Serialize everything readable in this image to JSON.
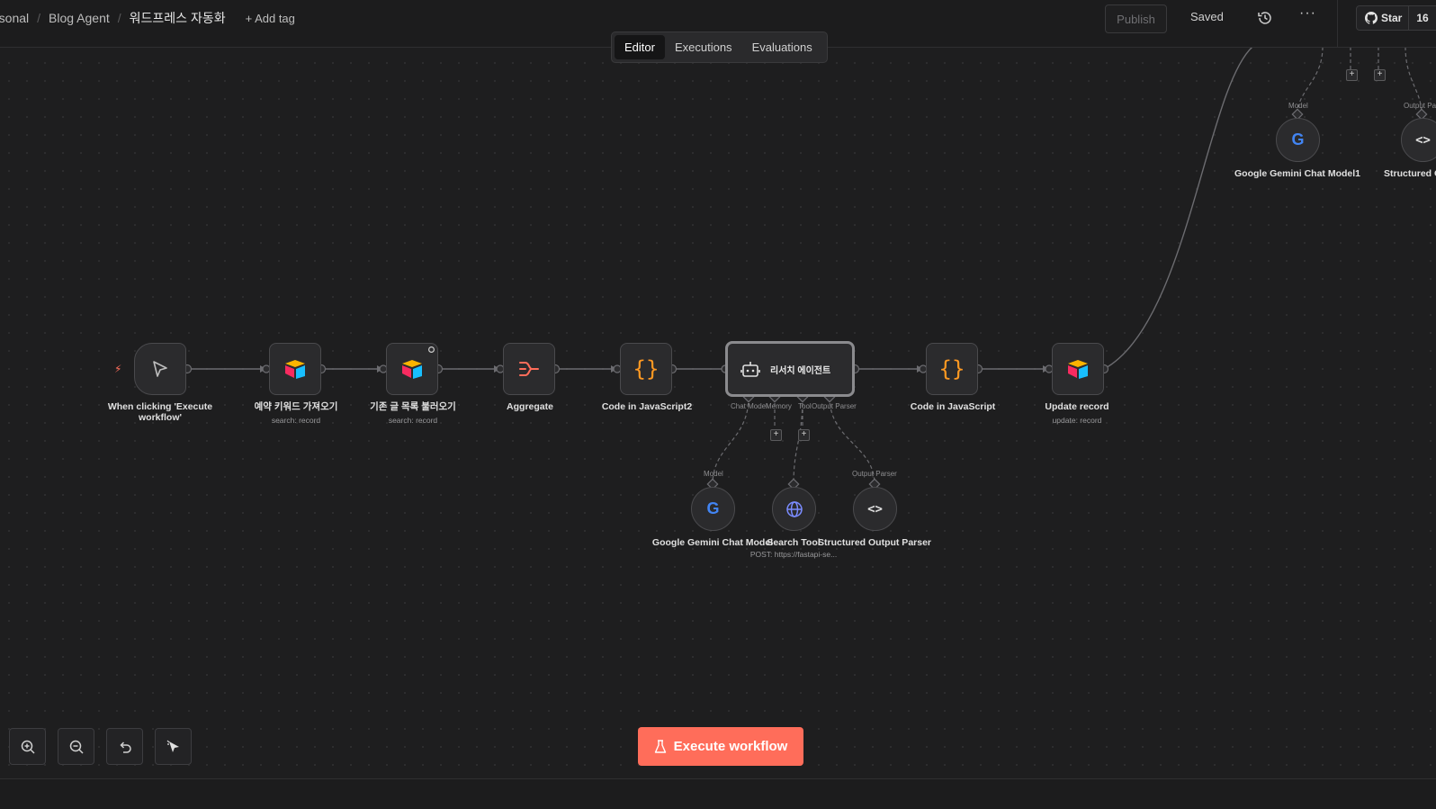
{
  "header": {
    "breadcrumb": [
      "rsonal",
      "Blog Agent",
      "워드프레스 자동화"
    ],
    "separator": "/",
    "add_tag": "+ Add tag",
    "publish": "Publish",
    "saved": "Saved",
    "more": "···",
    "github_star": "Star",
    "star_count": "16"
  },
  "tabs": [
    {
      "label": "Editor",
      "active": true
    },
    {
      "label": "Executions",
      "active": false
    },
    {
      "label": "Evaluations",
      "active": false
    }
  ],
  "nodes": {
    "trigger": {
      "title": "When clicking 'Execute workflow'",
      "icon": "cursor-icon"
    },
    "get_keywords": {
      "title": "예약 키워드 가져오기",
      "subtitle": "search: record",
      "icon": "airtable-icon"
    },
    "get_posts": {
      "title": "기존 글 목록 불러오기",
      "subtitle": "search: record",
      "icon": "airtable-icon"
    },
    "aggregate": {
      "title": "Aggregate",
      "icon": "aggregate-icon"
    },
    "code2": {
      "title": "Code in JavaScript2",
      "icon": "braces-icon"
    },
    "agent": {
      "title": "리서치 에이전트",
      "icon": "robot-icon"
    },
    "code": {
      "title": "Code in JavaScript",
      "icon": "braces-icon"
    },
    "update": {
      "title": "Update record",
      "subtitle": "update: record",
      "icon": "airtable-icon"
    }
  },
  "agent_ports": {
    "chat_model": "Chat Model",
    "memory": "Memory",
    "tool": "Tool",
    "output_parser": "Output Parser"
  },
  "subnodes": {
    "gemini": {
      "title": "Google Gemini Chat Model",
      "port": "Model",
      "icon": "google-icon"
    },
    "search": {
      "title": "Search Tool",
      "subtitle": "POST: https://fastapi-se...",
      "icon": "globe-icon"
    },
    "parser": {
      "title": "Structured Output Parser",
      "port": "Output Parser",
      "icon": "code-icon"
    },
    "gemini1": {
      "title": "Google Gemini Chat Model1",
      "port": "Model",
      "icon": "google-icon"
    },
    "parser1": {
      "title": "Structured Output Parser",
      "port": "Output Par",
      "icon": "code-icon"
    }
  },
  "execute_button": "Execute workflow",
  "colors": {
    "accent": "#ff6d5a",
    "background": "#1e1e1f",
    "node": "#2b2b2d",
    "code_orange": "#ff9922"
  }
}
